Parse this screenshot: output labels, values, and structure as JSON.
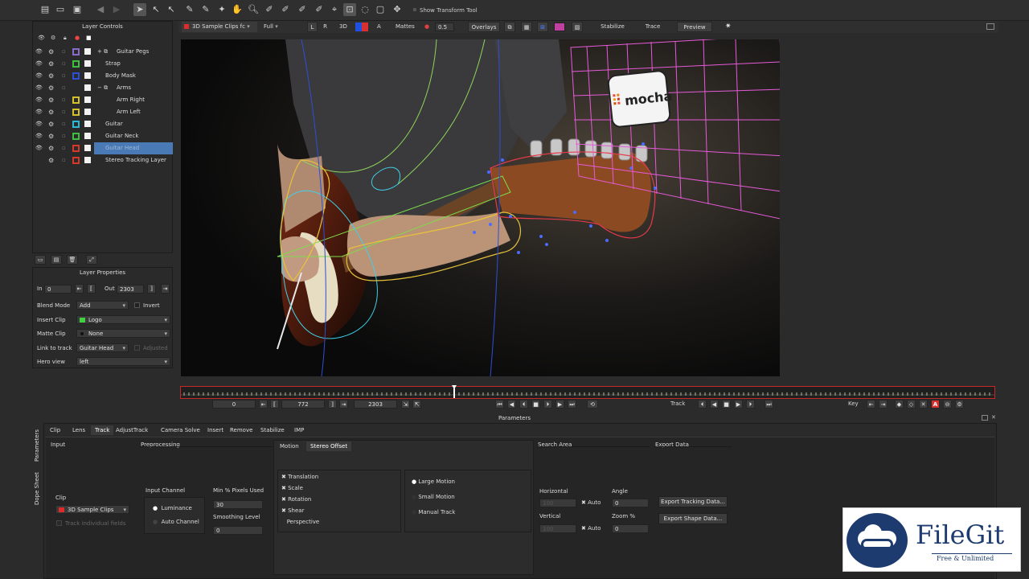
{
  "toolbar": {
    "show_transform_label": "Show Transform Tool",
    "icons": [
      "new-file-icon",
      "open-icon",
      "save-icon",
      "undo-icon",
      "redo-icon",
      "select-icon",
      "select-b-icon",
      "select-i-icon",
      "pen-x-icon",
      "pen-e-icon",
      "pen-a-icon",
      "hand-icon",
      "zoom-icon",
      "bspline-icon",
      "xspline-icon",
      "add-point-icon",
      "bspline-plus-icon",
      "pin-icon",
      "lock-icon",
      "orbit-icon",
      "shape-icon",
      "move-icon"
    ]
  },
  "layer_controls": {
    "title": "Layer Controls",
    "layers": [
      {
        "name": "Guitar Pegs",
        "color": "#8a6cc8",
        "indent": 1,
        "group": true
      },
      {
        "name": "Strap",
        "color": "#3fbf3f",
        "indent": 0
      },
      {
        "name": "Body Mask",
        "color": "#2d4fd6",
        "indent": 0
      },
      {
        "name": "Arms",
        "color": "",
        "indent": 1,
        "group": true
      },
      {
        "name": "Arm Right",
        "color": "#d4c02a",
        "indent": 2
      },
      {
        "name": "Arm Left",
        "color": "#d4c02a",
        "indent": 2
      },
      {
        "name": "Guitar",
        "color": "#2ab8d4",
        "indent": 0
      },
      {
        "name": "Guitar Neck",
        "color": "#3fbf3f",
        "indent": 0
      },
      {
        "name": "Guitar Head",
        "color": "#d43a2a",
        "indent": 0,
        "selected": true
      },
      {
        "name": "Stereo Tracking Layer",
        "color": "#d43a2a",
        "indent": 0
      }
    ]
  },
  "layer_properties": {
    "title": "Layer Properties",
    "in_label": "In",
    "in_value": "0",
    "out_label": "Out",
    "out_value": "2303",
    "blend_mode_label": "Blend Mode",
    "blend_mode_value": "Add",
    "invert_label": "Invert",
    "insert_clip_label": "Insert Clip",
    "insert_clip_value": "Logo",
    "matte_clip_label": "Matte Clip",
    "matte_clip_value": "None",
    "link_to_track_label": "Link to track",
    "link_to_track_value": "Guitar Head",
    "adjusted_label": "Adjusted",
    "hero_view_label": "Hero view",
    "hero_view_value": "left"
  },
  "viewer": {
    "clip_name": "3D Sample Clips fc",
    "quality": "Full",
    "l_label": "L",
    "r_label": "R",
    "threed_label": "3D",
    "a_label": "A",
    "mattes_label": "Mattes",
    "mattes_value": "0.5",
    "overlays_label": "Overlays",
    "stabilize_label": "Stabilize",
    "trace_label": "Trace",
    "preview_label": "Preview",
    "logo_text": "mocha"
  },
  "transport": {
    "start_frame": "0",
    "current_frame": "772",
    "end_frame": "2303",
    "track_label": "Track",
    "key_label": "Key"
  },
  "parameters": {
    "title": "Parameters",
    "tabs": [
      "Clip",
      "Lens",
      "Track",
      "AdjustTrack",
      "Camera Solve",
      "Insert",
      "Remove",
      "Stabilize",
      "IMP"
    ],
    "active_tab": "Track",
    "side_tabs": [
      "Parameters",
      "Dope Sheet"
    ],
    "input_label": "Input",
    "clip_label": "Clip",
    "clip_value": "3D Sample Clips",
    "track_individual_fields": "Track individual fields",
    "preprocessing_label": "Preprocessing",
    "input_channel_label": "Input Channel",
    "luminance_label": "Luminance",
    "auto_channel_label": "Auto Channel",
    "min_pixels_label": "Min % Pixels Used",
    "min_pixels_value": "30",
    "smoothing_label": "Smoothing Level",
    "smoothing_value": "0",
    "motion_tab": "Motion",
    "stereo_offset_tab": "Stereo Offset",
    "motion_checks": [
      "Translation",
      "Scale",
      "Rotation",
      "Shear",
      "Perspective"
    ],
    "motion_types": [
      "Large Motion",
      "Small Motion",
      "Manual Track"
    ],
    "search_area_label": "Search Area",
    "horizontal_label": "Horizontal",
    "horizontal_value": "100",
    "vertical_label": "Vertical",
    "vertical_value": "100",
    "auto_label": "Auto",
    "angle_label": "Angle",
    "angle_value": "0",
    "zoom_label": "Zoom %",
    "zoom_value": "0",
    "export_data_label": "Export Data",
    "export_tracking_btn": "Export Tracking Data...",
    "export_shape_btn": "Export Shape Data..."
  },
  "watermark": {
    "brand": "FileGit",
    "tagline": "Free & Unlimited"
  }
}
